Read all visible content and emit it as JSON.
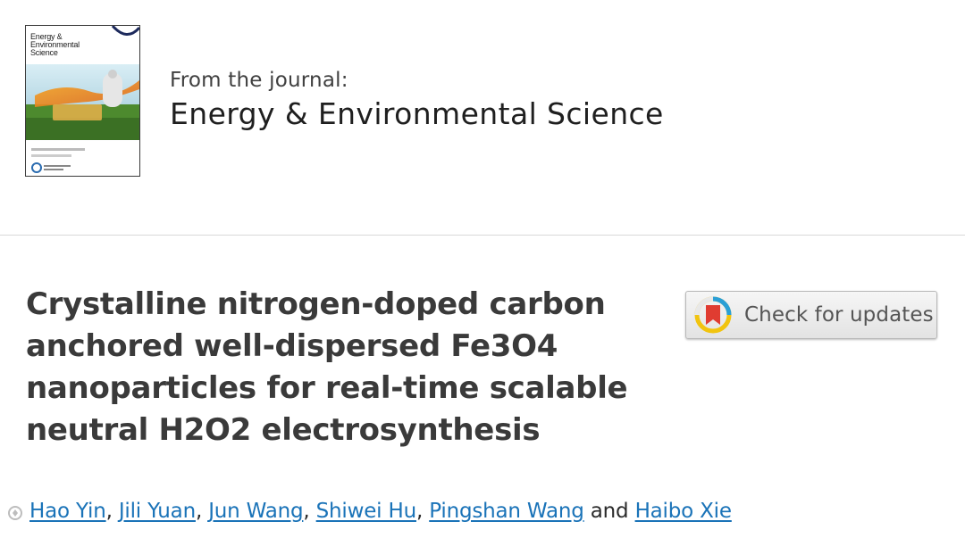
{
  "journal": {
    "from_label": "From the journal:",
    "name": "Energy & Environmental Science",
    "cover_title_lines": [
      "Energy &",
      "Environmental",
      "Science"
    ]
  },
  "article": {
    "title": "Crystalline nitrogen-doped carbon anchored well-dispersed Fe3O4 nanoparticles for real-time scalable neutral H2O2 electrosynthesis"
  },
  "check_updates": {
    "label": "Check for updates",
    "icon": "crossmark-icon"
  },
  "authors": {
    "names": [
      "Hao Yin",
      "Jili Yuan",
      "Jun Wang",
      "Shiwei Hu",
      "Pingshan Wang",
      "Haibo Xie"
    ],
    "separator": ",",
    "conjunction": "and"
  },
  "colors": {
    "link": "#1a73b8",
    "title_text": "#3a3a3a",
    "divider": "#d8d8d8"
  }
}
